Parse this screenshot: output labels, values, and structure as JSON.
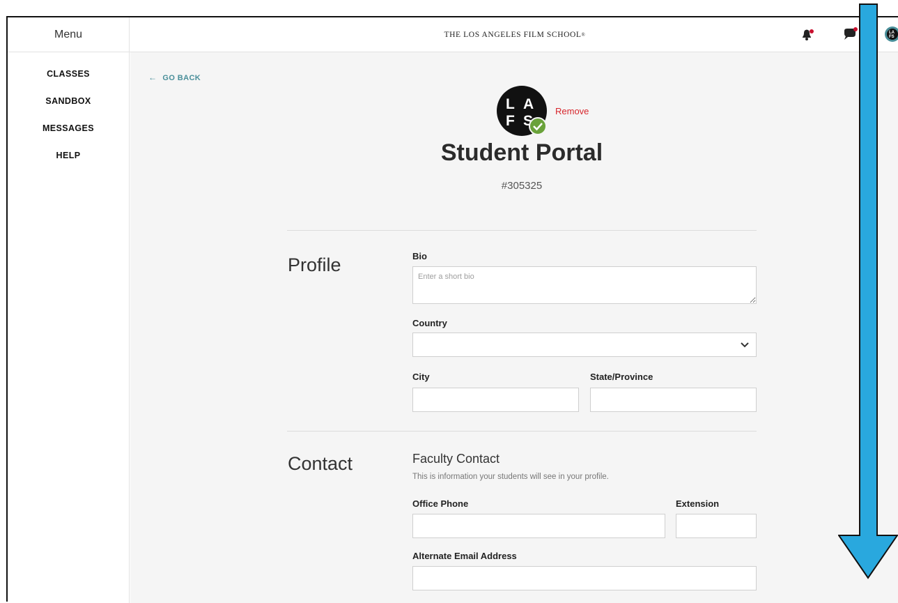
{
  "header": {
    "menu_label": "Menu",
    "brand": "THE LOS ANGELES FILM SCHOOL",
    "brand_mark": "®",
    "notification_color": "#c8102e"
  },
  "sidebar": {
    "items": [
      {
        "label": "CLASSES"
      },
      {
        "label": "SANDBOX"
      },
      {
        "label": "MESSAGES"
      },
      {
        "label": "HELP"
      }
    ]
  },
  "main": {
    "go_back": "GO BACK",
    "remove": "Remove",
    "title": "Student Portal",
    "id_number": "#305325",
    "avatar_letters": [
      "L",
      "A",
      "F",
      "S"
    ],
    "profile": {
      "heading": "Profile",
      "bio_label": "Bio",
      "bio_placeholder": "Enter a short bio",
      "country_label": "Country",
      "country_value": "",
      "city_label": "City",
      "city_value": "",
      "state_label": "State/Province",
      "state_value": ""
    },
    "contact": {
      "heading": "Contact",
      "faculty_title": "Faculty Contact",
      "faculty_subtitle": "This is information your students will see in your profile.",
      "office_phone_label": "Office Phone",
      "office_phone_value": "",
      "extension_label": "Extension",
      "extension_value": "",
      "alt_email_label": "Alternate Email Address",
      "alt_email_value": ""
    }
  },
  "colors": {
    "accent": "#4a8f9a",
    "remove": "#d7262c",
    "verified": "#6aa23a",
    "scroll_arrow": "#29a8de"
  }
}
